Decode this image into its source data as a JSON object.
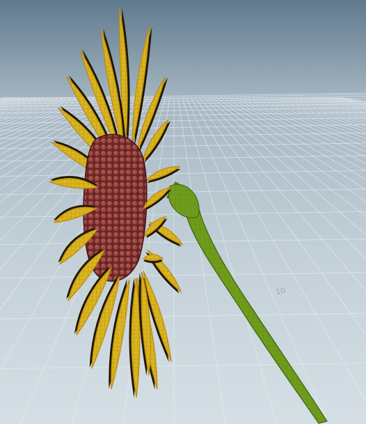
{
  "viewport": {
    "grid": {
      "visible": true,
      "ground_label": "10"
    },
    "model": {
      "name": "sunflower",
      "parts": [
        "petals",
        "seed-head",
        "stem"
      ]
    },
    "colors": {
      "sky_top": "#5f7a8e",
      "horizon": "#a7b7c3",
      "ground": "#c3d0d8",
      "grid_line": "#e8eef2",
      "petal": "#d9b51f",
      "petal_dark": "#8a6c06",
      "petal_edge": "#c08a10",
      "seed_head": "#7a2b2b",
      "seed_dot": "#9c4a45",
      "stem": "#6f9d1b",
      "stem_dark": "#3f5d0d",
      "wire": "#2b2200"
    }
  }
}
